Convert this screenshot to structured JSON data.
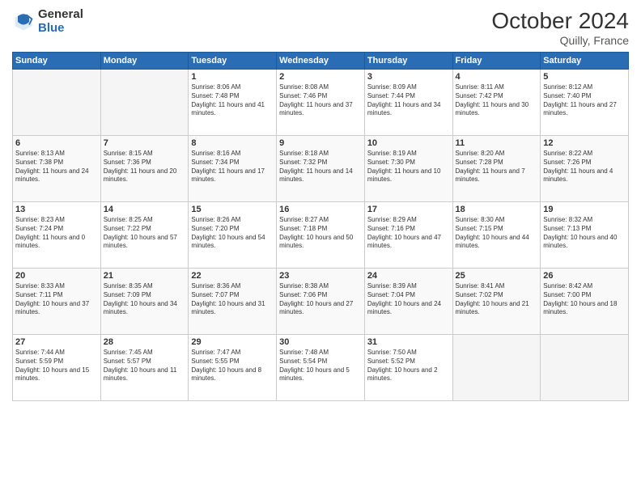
{
  "logo": {
    "general": "General",
    "blue": "Blue"
  },
  "header": {
    "month": "October 2024",
    "location": "Quilly, France"
  },
  "weekdays": [
    "Sunday",
    "Monday",
    "Tuesday",
    "Wednesday",
    "Thursday",
    "Friday",
    "Saturday"
  ],
  "weeks": [
    [
      {
        "day": null
      },
      {
        "day": null
      },
      {
        "day": "1",
        "sunrise": "Sunrise: 8:06 AM",
        "sunset": "Sunset: 7:48 PM",
        "daylight": "Daylight: 11 hours and 41 minutes."
      },
      {
        "day": "2",
        "sunrise": "Sunrise: 8:08 AM",
        "sunset": "Sunset: 7:46 PM",
        "daylight": "Daylight: 11 hours and 37 minutes."
      },
      {
        "day": "3",
        "sunrise": "Sunrise: 8:09 AM",
        "sunset": "Sunset: 7:44 PM",
        "daylight": "Daylight: 11 hours and 34 minutes."
      },
      {
        "day": "4",
        "sunrise": "Sunrise: 8:11 AM",
        "sunset": "Sunset: 7:42 PM",
        "daylight": "Daylight: 11 hours and 30 minutes."
      },
      {
        "day": "5",
        "sunrise": "Sunrise: 8:12 AM",
        "sunset": "Sunset: 7:40 PM",
        "daylight": "Daylight: 11 hours and 27 minutes."
      }
    ],
    [
      {
        "day": "6",
        "sunrise": "Sunrise: 8:13 AM",
        "sunset": "Sunset: 7:38 PM",
        "daylight": "Daylight: 11 hours and 24 minutes."
      },
      {
        "day": "7",
        "sunrise": "Sunrise: 8:15 AM",
        "sunset": "Sunset: 7:36 PM",
        "daylight": "Daylight: 11 hours and 20 minutes."
      },
      {
        "day": "8",
        "sunrise": "Sunrise: 8:16 AM",
        "sunset": "Sunset: 7:34 PM",
        "daylight": "Daylight: 11 hours and 17 minutes."
      },
      {
        "day": "9",
        "sunrise": "Sunrise: 8:18 AM",
        "sunset": "Sunset: 7:32 PM",
        "daylight": "Daylight: 11 hours and 14 minutes."
      },
      {
        "day": "10",
        "sunrise": "Sunrise: 8:19 AM",
        "sunset": "Sunset: 7:30 PM",
        "daylight": "Daylight: 11 hours and 10 minutes."
      },
      {
        "day": "11",
        "sunrise": "Sunrise: 8:20 AM",
        "sunset": "Sunset: 7:28 PM",
        "daylight": "Daylight: 11 hours and 7 minutes."
      },
      {
        "day": "12",
        "sunrise": "Sunrise: 8:22 AM",
        "sunset": "Sunset: 7:26 PM",
        "daylight": "Daylight: 11 hours and 4 minutes."
      }
    ],
    [
      {
        "day": "13",
        "sunrise": "Sunrise: 8:23 AM",
        "sunset": "Sunset: 7:24 PM",
        "daylight": "Daylight: 11 hours and 0 minutes."
      },
      {
        "day": "14",
        "sunrise": "Sunrise: 8:25 AM",
        "sunset": "Sunset: 7:22 PM",
        "daylight": "Daylight: 10 hours and 57 minutes."
      },
      {
        "day": "15",
        "sunrise": "Sunrise: 8:26 AM",
        "sunset": "Sunset: 7:20 PM",
        "daylight": "Daylight: 10 hours and 54 minutes."
      },
      {
        "day": "16",
        "sunrise": "Sunrise: 8:27 AM",
        "sunset": "Sunset: 7:18 PM",
        "daylight": "Daylight: 10 hours and 50 minutes."
      },
      {
        "day": "17",
        "sunrise": "Sunrise: 8:29 AM",
        "sunset": "Sunset: 7:16 PM",
        "daylight": "Daylight: 10 hours and 47 minutes."
      },
      {
        "day": "18",
        "sunrise": "Sunrise: 8:30 AM",
        "sunset": "Sunset: 7:15 PM",
        "daylight": "Daylight: 10 hours and 44 minutes."
      },
      {
        "day": "19",
        "sunrise": "Sunrise: 8:32 AM",
        "sunset": "Sunset: 7:13 PM",
        "daylight": "Daylight: 10 hours and 40 minutes."
      }
    ],
    [
      {
        "day": "20",
        "sunrise": "Sunrise: 8:33 AM",
        "sunset": "Sunset: 7:11 PM",
        "daylight": "Daylight: 10 hours and 37 minutes."
      },
      {
        "day": "21",
        "sunrise": "Sunrise: 8:35 AM",
        "sunset": "Sunset: 7:09 PM",
        "daylight": "Daylight: 10 hours and 34 minutes."
      },
      {
        "day": "22",
        "sunrise": "Sunrise: 8:36 AM",
        "sunset": "Sunset: 7:07 PM",
        "daylight": "Daylight: 10 hours and 31 minutes."
      },
      {
        "day": "23",
        "sunrise": "Sunrise: 8:38 AM",
        "sunset": "Sunset: 7:06 PM",
        "daylight": "Daylight: 10 hours and 27 minutes."
      },
      {
        "day": "24",
        "sunrise": "Sunrise: 8:39 AM",
        "sunset": "Sunset: 7:04 PM",
        "daylight": "Daylight: 10 hours and 24 minutes."
      },
      {
        "day": "25",
        "sunrise": "Sunrise: 8:41 AM",
        "sunset": "Sunset: 7:02 PM",
        "daylight": "Daylight: 10 hours and 21 minutes."
      },
      {
        "day": "26",
        "sunrise": "Sunrise: 8:42 AM",
        "sunset": "Sunset: 7:00 PM",
        "daylight": "Daylight: 10 hours and 18 minutes."
      }
    ],
    [
      {
        "day": "27",
        "sunrise": "Sunrise: 7:44 AM",
        "sunset": "Sunset: 5:59 PM",
        "daylight": "Daylight: 10 hours and 15 minutes."
      },
      {
        "day": "28",
        "sunrise": "Sunrise: 7:45 AM",
        "sunset": "Sunset: 5:57 PM",
        "daylight": "Daylight: 10 hours and 11 minutes."
      },
      {
        "day": "29",
        "sunrise": "Sunrise: 7:47 AM",
        "sunset": "Sunset: 5:55 PM",
        "daylight": "Daylight: 10 hours and 8 minutes."
      },
      {
        "day": "30",
        "sunrise": "Sunrise: 7:48 AM",
        "sunset": "Sunset: 5:54 PM",
        "daylight": "Daylight: 10 hours and 5 minutes."
      },
      {
        "day": "31",
        "sunrise": "Sunrise: 7:50 AM",
        "sunset": "Sunset: 5:52 PM",
        "daylight": "Daylight: 10 hours and 2 minutes."
      },
      {
        "day": null
      },
      {
        "day": null
      }
    ]
  ]
}
